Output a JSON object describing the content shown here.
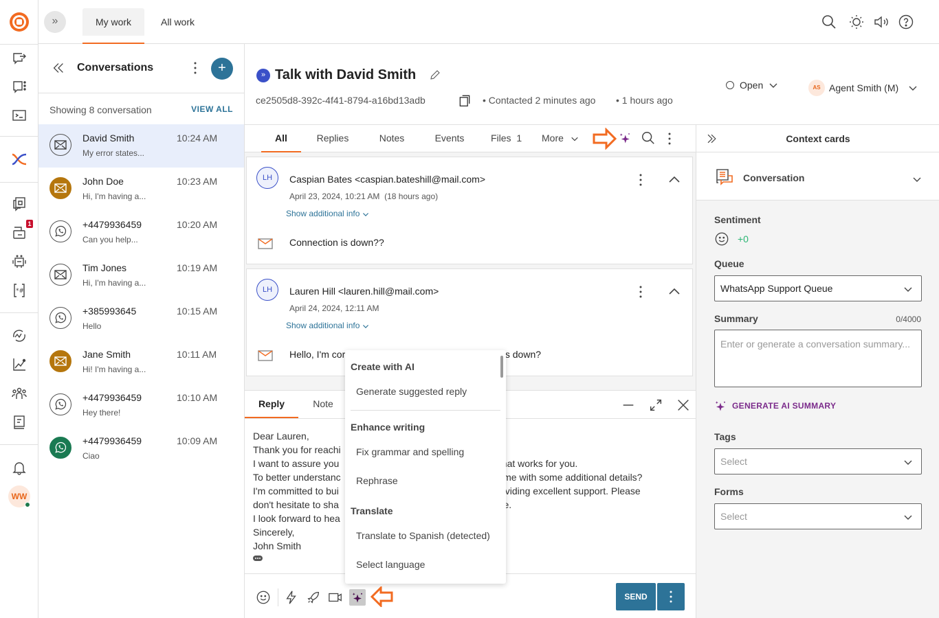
{
  "topbar": {
    "tabs": [
      {
        "label": "My work",
        "active": true
      },
      {
        "label": "All work",
        "active": false
      }
    ],
    "icons": [
      "search-icon",
      "theme-icon",
      "sound-icon",
      "help-icon"
    ]
  },
  "rail": {
    "badge_count": "1",
    "user_initials": "WW",
    "icons": [
      "logo-icon",
      "outbound-icon",
      "chat-menu-icon",
      "terminal-icon",
      "connect-icon",
      "knowledge-icon",
      "inbox-icon",
      "bot-icon",
      "template-icon",
      "integrations-icon",
      "analytics-icon",
      "people-icon",
      "book-icon",
      "bell-icon"
    ]
  },
  "conversations": {
    "title": "Conversations",
    "showing": "Showing 8 conversation",
    "view_all": "VIEW ALL",
    "add_label": "+",
    "items": [
      {
        "name": "David Smith",
        "time": "10:24 AM",
        "preview": "My error states...",
        "channel": "email",
        "style": "outline",
        "selected": true
      },
      {
        "name": "John Doe",
        "time": "10:23 AM",
        "preview": "Hi, I'm having a...",
        "channel": "email",
        "style": "filled",
        "selected": false
      },
      {
        "name": "+4479936459",
        "time": "10:20 AM",
        "preview": "Can you help...",
        "channel": "whatsapp",
        "style": "outline",
        "selected": false
      },
      {
        "name": "Tim Jones",
        "time": "10:19 AM",
        "preview": "Hi, I'm having a...",
        "channel": "email",
        "style": "outline",
        "selected": false
      },
      {
        "name": "+385993645",
        "time": "10:15 AM",
        "preview": "Hello",
        "channel": "whatsapp",
        "style": "outline",
        "selected": false
      },
      {
        "name": "Jane Smith",
        "time": "10:11 AM",
        "preview": "Hi! I'm having a...",
        "channel": "email",
        "style": "filled",
        "selected": false
      },
      {
        "name": "+4479936459",
        "time": "10:10 AM",
        "preview": "Hey there!",
        "channel": "whatsapp",
        "style": "outline",
        "selected": false
      },
      {
        "name": "+4479936459",
        "time": "10:09 AM",
        "preview": "Ciao",
        "channel": "whatsapp",
        "style": "filled",
        "selected": false
      }
    ]
  },
  "conversation": {
    "title": "Talk with David Smith",
    "id": "ce2505d8-392c-4f41-8794-a16bd13adb",
    "contacted": "• Contacted 2 minutes ago",
    "age": "• 1 hours ago",
    "status": "Open",
    "agent_initials": "AS",
    "agent": "Agent Smith (M)",
    "tabs": [
      {
        "label": "All",
        "active": true
      },
      {
        "label": "Replies",
        "active": false
      },
      {
        "label": "Notes",
        "active": false
      },
      {
        "label": "Events",
        "active": false
      },
      {
        "label": "Files",
        "count": "1",
        "active": false
      },
      {
        "label": "More",
        "active": false
      }
    ],
    "messages": [
      {
        "initials": "LH",
        "from": "Caspian Bates <caspian.bateshill@mail.com>",
        "date": "April 23, 2024, 10:21 AM  (18 hours ago)",
        "more": "Show additional info",
        "body": "Connection is down??"
      },
      {
        "initials": "LH",
        "from": "Lauren Hill <lauren.hill@mail.com>",
        "date": "April 24, 2024, 12:11 AM",
        "more": "Show additional info",
        "body": "Hello, I'm cor                                                  page is down?"
      }
    ]
  },
  "reply": {
    "tabs": [
      {
        "label": "Reply",
        "active": true
      },
      {
        "label": "Note",
        "active": false
      }
    ],
    "text": "Dear Lauren,\nThank you for reachi                                                 cerns.\nI want to assure you                                                   ution that works for you.\nTo better understanc                                                  rovide me with some additional details?\nI'm committed to bui                                                  and providing excellent support. Please\ndon't hesitate to sha                                                 nay have.\nI look forward to hea\nSincerely,\nJohn Smith",
    "send_label": "SEND"
  },
  "ai_menu": {
    "sections": [
      {
        "heading": "Create with AI",
        "items": [
          "Generate suggested reply"
        ]
      },
      {
        "heading": "Enhance writing",
        "items": [
          "Fix grammar and spelling",
          "Rephrase"
        ]
      },
      {
        "heading": "Translate",
        "items": [
          "Translate to Spanish (detected)",
          "Select language"
        ]
      }
    ]
  },
  "context": {
    "title": "Context cards",
    "card_title": "Conversation",
    "sentiment_label": "Sentiment",
    "sentiment_value": "+0",
    "queue_label": "Queue",
    "queue_value": "WhatsApp Support Queue",
    "summary_label": "Summary",
    "summary_count": "0/4000",
    "summary_placeholder": "Enter or generate a conversation summary...",
    "generate_label": "GENERATE AI SUMMARY",
    "tags_label": "Tags",
    "tags_placeholder": "Select",
    "forms_label": "Forms",
    "forms_placeholder": "Select"
  },
  "colors": {
    "accent": "#f26b21",
    "primary": "#2d7398",
    "ai": "#7b2b8b",
    "sentiment": "#2bb673"
  }
}
